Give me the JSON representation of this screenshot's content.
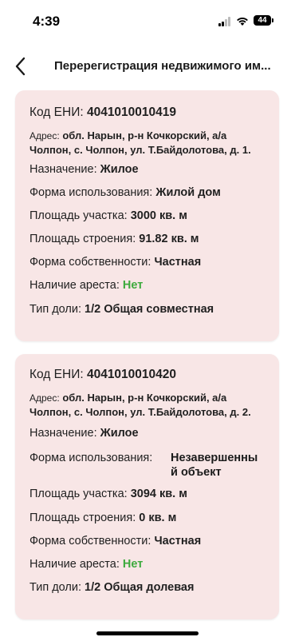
{
  "status_bar": {
    "time": "4:39",
    "battery": "44"
  },
  "nav": {
    "title": "Перерегистрация недвижимого им..."
  },
  "properties": [
    {
      "code_label": "Код ЕНИ:",
      "code_value": "4041010010419",
      "address_label": "Адрес:",
      "address_value": "обл. Нарын, р-н Кочкорский, а/а Чолпон, с. Чолпон, ул. Т.Байдолотова, д. 1.",
      "purpose_label": "Назначение:",
      "purpose_value": "Жилое",
      "usage_label": "Форма использования:",
      "usage_value": "Жилой дом",
      "land_area_label": "Площадь участка:",
      "land_area_value": "3000 кв. м",
      "building_area_label": "Площадь строения:",
      "building_area_value": "91.82 кв. м",
      "ownership_label": "Форма собственности:",
      "ownership_value": "Частная",
      "arrest_label": "Наличие ареста:",
      "arrest_value": "Нет",
      "share_label": "Тип доли:",
      "share_value": "1/2 Общая совместная"
    },
    {
      "code_label": "Код ЕНИ:",
      "code_value": "4041010010420",
      "address_label": "Адрес:",
      "address_value": "обл. Нарын, р-н Кочкорский, а/а Чолпон, с. Чолпон, ул. Т.Байдолотова, д. 2.",
      "purpose_label": "Назначение:",
      "purpose_value": "Жилое",
      "usage_label": "Форма использования:",
      "usage_value": "Незавершенный объект",
      "land_area_label": "Площадь участка:",
      "land_area_value": "3094 кв. м",
      "building_area_label": "Площадь строения:",
      "building_area_value": "0 кв. м",
      "ownership_label": "Форма собственности:",
      "ownership_value": "Частная",
      "arrest_label": "Наличие ареста:",
      "arrest_value": "Нет",
      "share_label": "Тип доли:",
      "share_value": "1/2 Общая долевая"
    }
  ]
}
